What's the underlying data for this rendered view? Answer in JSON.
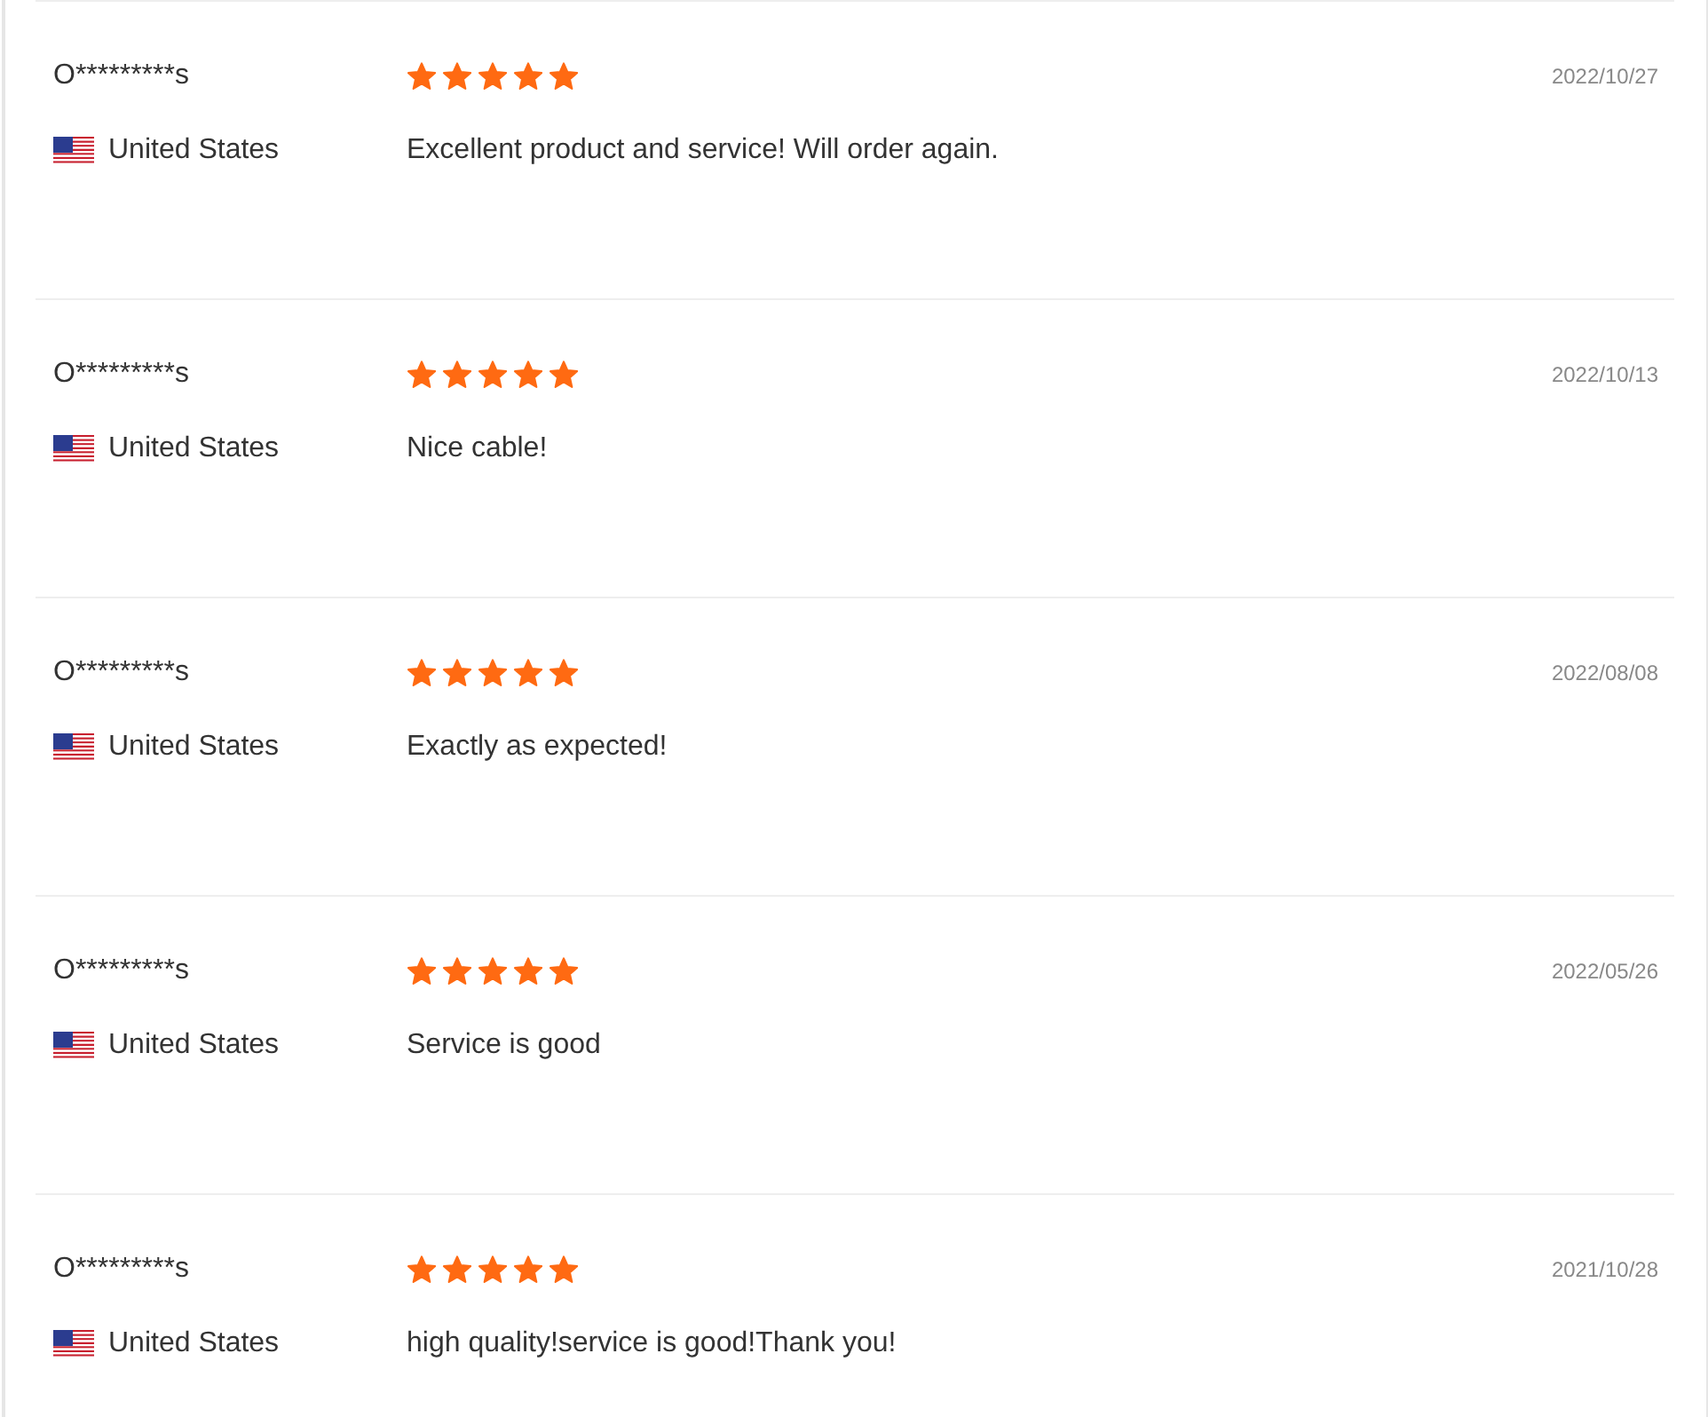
{
  "reviews": [
    {
      "user": "O*********s",
      "country": "United States",
      "stars": 5,
      "date": "2022/10/27",
      "text": "Excellent product and service! Will order again."
    },
    {
      "user": "O*********s",
      "country": "United States",
      "stars": 5,
      "date": "2022/10/13",
      "text": "Nice cable!"
    },
    {
      "user": "O*********s",
      "country": "United States",
      "stars": 5,
      "date": "2022/08/08",
      "text": "Exactly as expected!"
    },
    {
      "user": "O*********s",
      "country": "United States",
      "stars": 5,
      "date": "2022/05/26",
      "text": "Service is good"
    },
    {
      "user": "O*********s",
      "country": "United States",
      "stars": 5,
      "date": "2021/10/28",
      "text": "high quality!service is good!Thank you!"
    }
  ]
}
